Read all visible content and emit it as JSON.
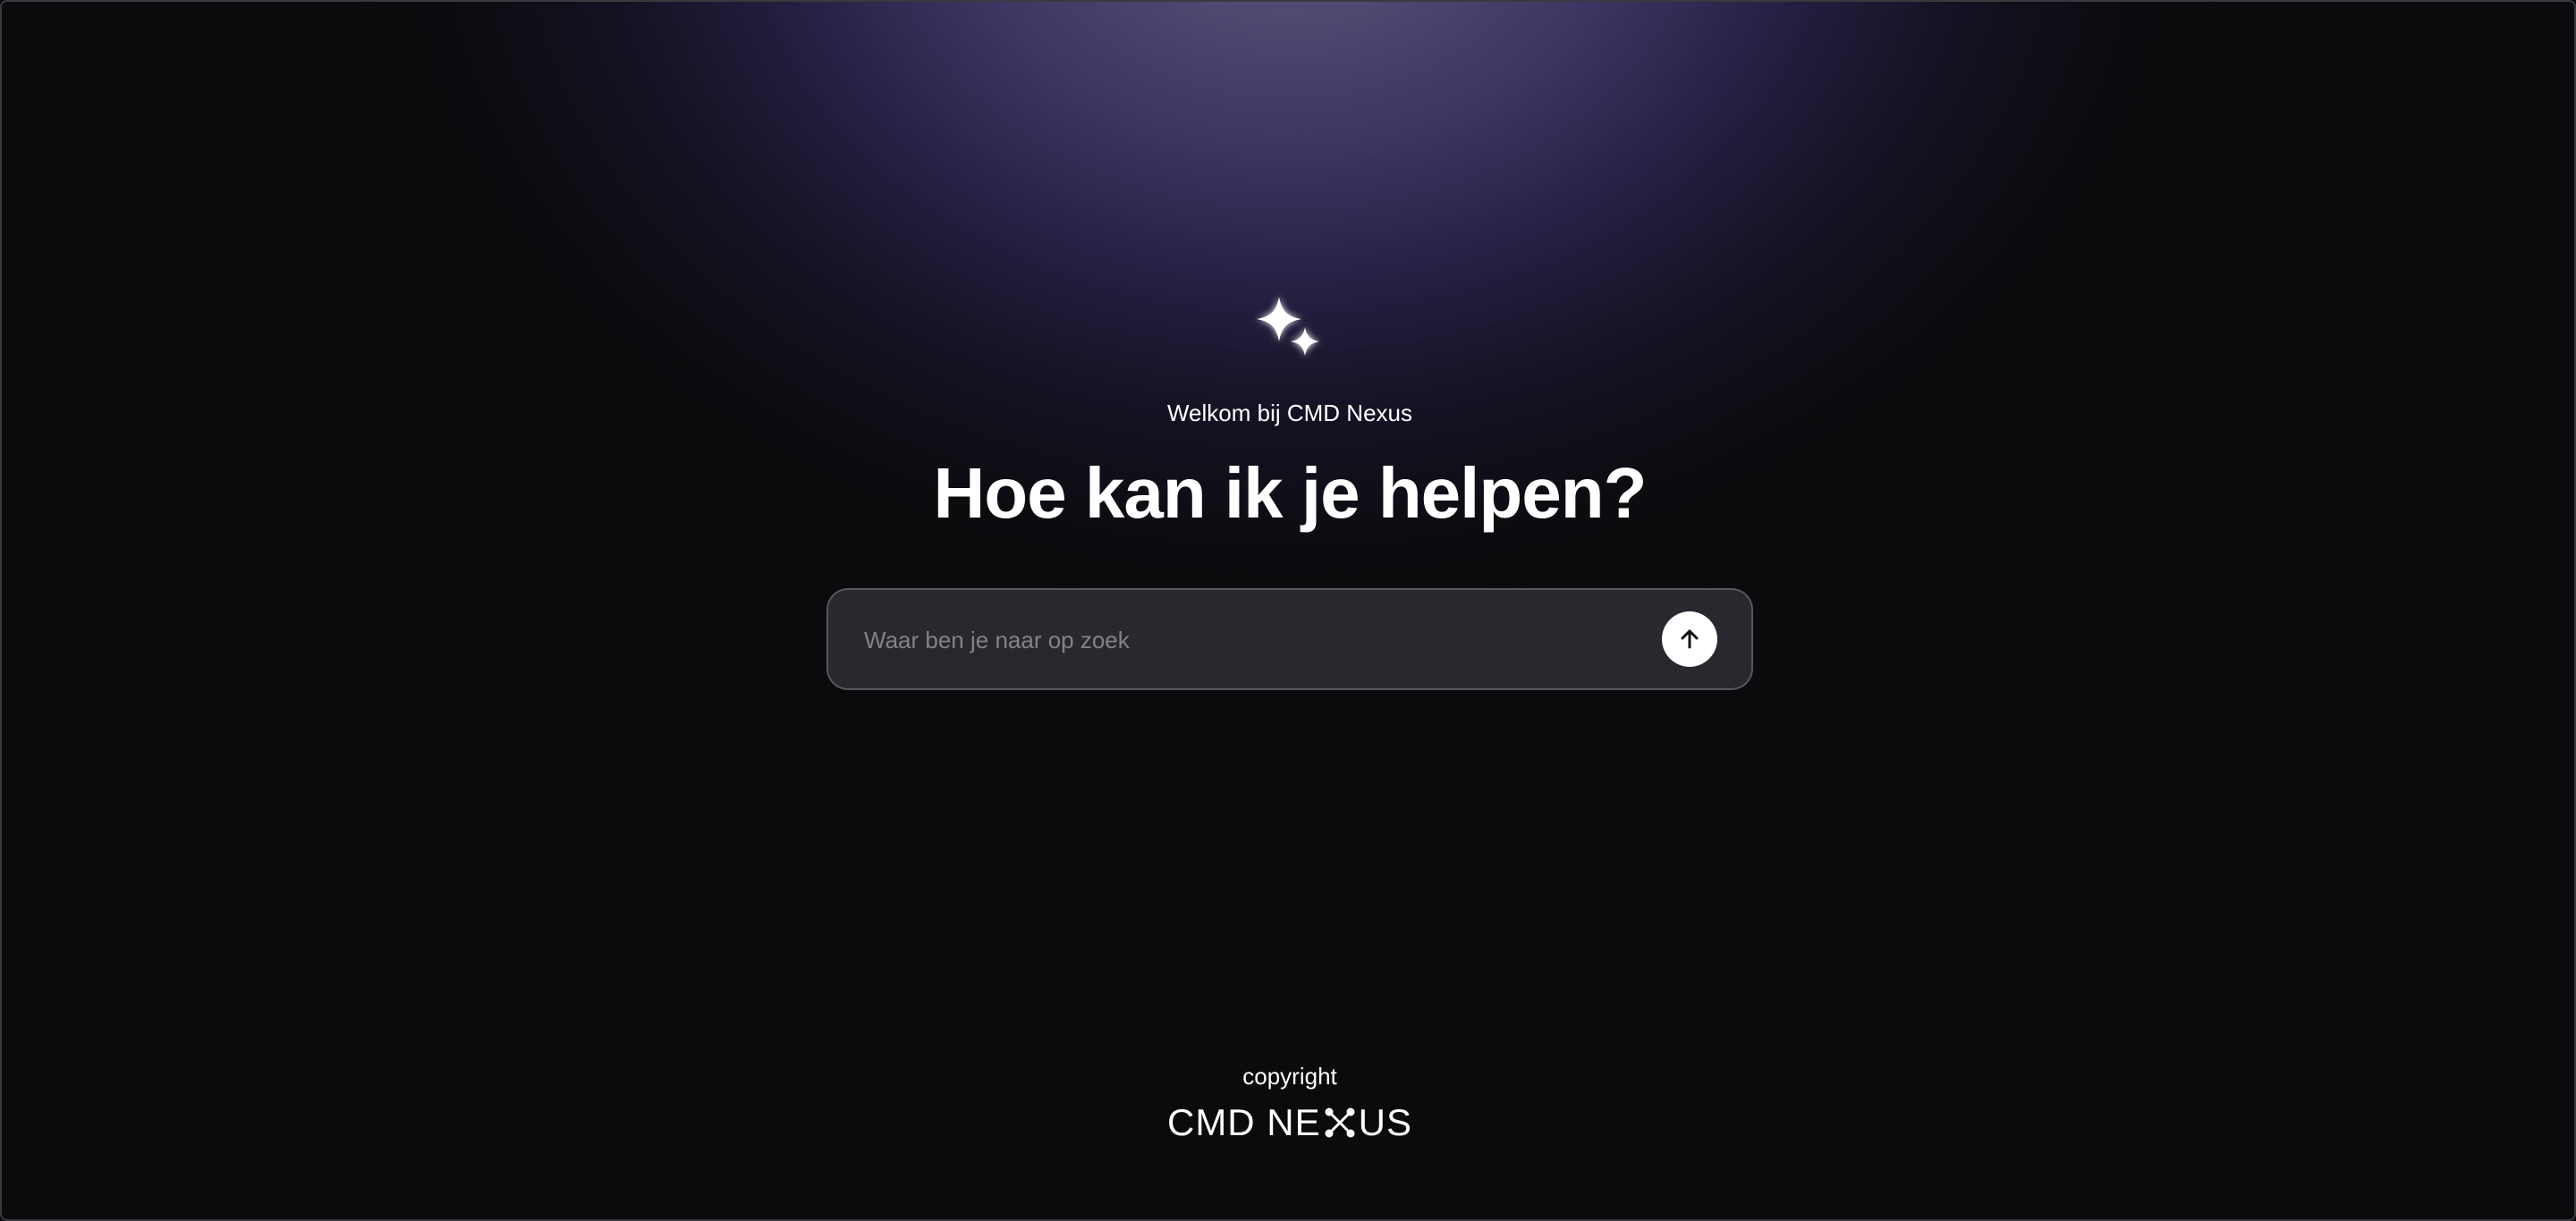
{
  "hero": {
    "welcome": "Welkom bij CMD Nexus",
    "headline": "Hoe kan ik je helpen?"
  },
  "search": {
    "placeholder": "Waar ben je naar op zoek",
    "value": ""
  },
  "footer": {
    "copyright": "copyright",
    "brand": {
      "full": "CMD NEXUS",
      "prefix": "CMD NE",
      "suffix": "US"
    }
  },
  "icons": {
    "hero": "sparkle-icon",
    "send": "arrow-up-icon",
    "brand_x": "x-mark-icon"
  },
  "colors": {
    "background": "#0b0b0d",
    "glow": "#5a4a9a",
    "text": "#ffffff",
    "send_button": "#ffffff"
  }
}
